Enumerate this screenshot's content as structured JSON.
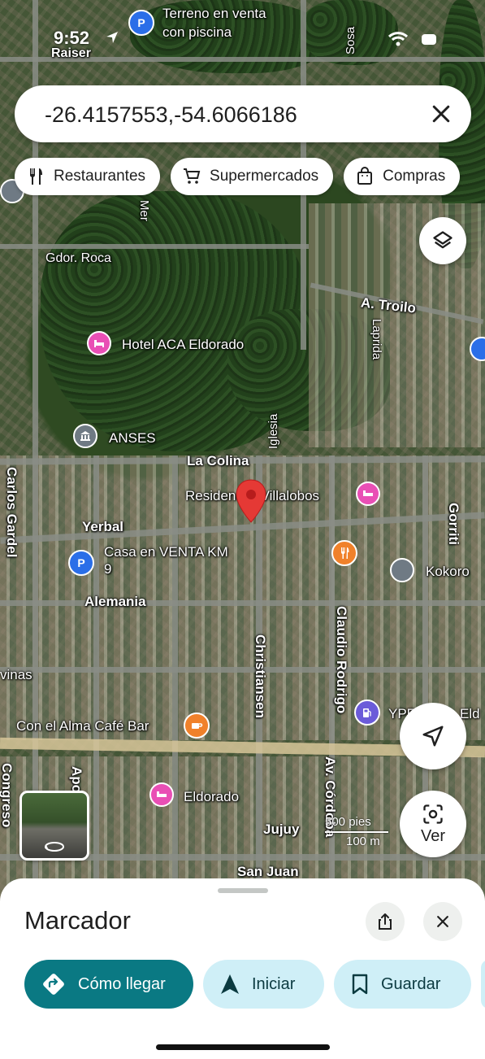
{
  "status_bar": {
    "time": "9:52",
    "carrier_label": "Raiser"
  },
  "search": {
    "value": "-26.4157553,-54.6066186",
    "close_icon": "close-icon"
  },
  "chips": [
    {
      "label": "Restaurantes",
      "icon": "restaurant-icon"
    },
    {
      "label": "Supermercados",
      "icon": "cart-icon"
    },
    {
      "label": "Compras",
      "icon": "shopping-bag-icon"
    }
  ],
  "map": {
    "places": {
      "terreno_line1": "Terreno en venta",
      "terreno_line2": "con piscina",
      "hotel": "Hotel ACA Eldorado",
      "anses": "ANSES",
      "residencial": "Residencial Villalobos",
      "casa_line1": "Casa en VENTA KM",
      "casa_line2": "9",
      "kokoro": "Kokoro",
      "cafe": "Con el Alma Café Bar",
      "eldorado": "Eldorado",
      "ypf": "YPF",
      "eldo_partial": "Eld"
    },
    "streets": {
      "gdor_roca": "Gdor. Roca",
      "troilo": "A. Troilo",
      "laprida": "Laprida",
      "la_colina": "La Colina",
      "iglesia": "Iglesia",
      "yerbal": "Yerbal",
      "alemania": "Alemania",
      "carlos_gardel": "Carlos Gardel",
      "gorriti": "Gorriti",
      "christiansen": "Christiansen",
      "claudio_rodrigo": "Claudio Rodrigo",
      "av_cordoba": "Av. Córdoba",
      "jujuy": "Jujuy",
      "san_juan": "San Juan",
      "congreso": "Congreso",
      "vinas": "vinas",
      "mer": "Mer",
      "sosa": "Sosa",
      "apo": "Apo"
    },
    "scale": {
      "top": "500 pies",
      "bottom": "100 m"
    }
  },
  "map_controls": {
    "ver_label": "Ver"
  },
  "sheet": {
    "title": "Marcador",
    "actions": [
      {
        "label": "Cómo llegar",
        "icon": "directions-icon"
      },
      {
        "label": "Iniciar",
        "icon": "navigation-arrow-icon"
      },
      {
        "label": "Guardar",
        "icon": "bookmark-icon"
      }
    ]
  },
  "colors": {
    "primary": "#0a7983",
    "secondary": "#cfeff7",
    "pin_red": "#e53935",
    "lodging_pink": "#e94fb5",
    "food_orange": "#f0812b",
    "parking_blue": "#2a6ee8"
  }
}
